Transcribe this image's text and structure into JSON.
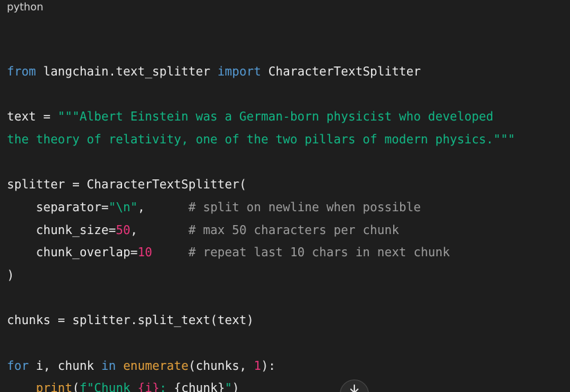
{
  "code_block": {
    "language": "python",
    "lines": [
      [],
      [
        {
          "cls": "kw",
          "text": "from"
        },
        {
          "cls": "plain",
          "text": " langchain.text_splitter "
        },
        {
          "cls": "kw",
          "text": "import"
        },
        {
          "cls": "plain",
          "text": " CharacterTextSplitter"
        }
      ],
      [],
      [
        {
          "cls": "plain",
          "text": "text = "
        },
        {
          "cls": "str",
          "text": "\"\"\"Albert Einstein was a German-born physicist who developed"
        }
      ],
      [
        {
          "cls": "str",
          "text": "the theory of relativity, one of the two pillars of modern physics.\"\"\""
        }
      ],
      [],
      [
        {
          "cls": "plain",
          "text": "splitter = CharacterTextSplitter("
        }
      ],
      [
        {
          "cls": "plain",
          "text": "    separator="
        },
        {
          "cls": "str",
          "text": "\"\\n\""
        },
        {
          "cls": "plain",
          "text": ",      "
        },
        {
          "cls": "com",
          "text": "# split on newline when possible"
        }
      ],
      [
        {
          "cls": "plain",
          "text": "    chunk_size="
        },
        {
          "cls": "num",
          "text": "50"
        },
        {
          "cls": "plain",
          "text": ",       "
        },
        {
          "cls": "com",
          "text": "# max 50 characters per chunk"
        }
      ],
      [
        {
          "cls": "plain",
          "text": "    chunk_overlap="
        },
        {
          "cls": "num",
          "text": "10"
        },
        {
          "cls": "plain",
          "text": "     "
        },
        {
          "cls": "com",
          "text": "# repeat last 10 chars in next chunk"
        }
      ],
      [
        {
          "cls": "plain",
          "text": ")"
        }
      ],
      [],
      [
        {
          "cls": "plain",
          "text": "chunks = splitter.split_text(text)"
        }
      ],
      [],
      [
        {
          "cls": "kw",
          "text": "for"
        },
        {
          "cls": "plain",
          "text": " i, chunk "
        },
        {
          "cls": "kw",
          "text": "in"
        },
        {
          "cls": "plain",
          "text": " "
        },
        {
          "cls": "fn",
          "text": "enumerate"
        },
        {
          "cls": "plain",
          "text": "(chunks, "
        },
        {
          "cls": "num",
          "text": "1"
        },
        {
          "cls": "plain",
          "text": "):"
        }
      ],
      [
        {
          "cls": "plain",
          "text": "    "
        },
        {
          "cls": "fn",
          "text": "print"
        },
        {
          "cls": "plain",
          "text": "("
        },
        {
          "cls": "str",
          "text": "f\"Chunk "
        },
        {
          "cls": "num",
          "text": "{i}"
        },
        {
          "cls": "str",
          "text": ": "
        },
        {
          "cls": "plain",
          "text": "{chunk}"
        },
        {
          "cls": "str",
          "text": "\""
        },
        {
          "cls": "plain",
          "text": ")"
        }
      ]
    ]
  },
  "scroll_button": {
    "icon": "arrow-down-icon"
  },
  "colors": {
    "background": "#1e1e1e",
    "keyword": "#569cd6",
    "string": "#12b886",
    "number": "#e9367a",
    "comment": "#9e9e9e",
    "builtin": "#e6a23c"
  }
}
